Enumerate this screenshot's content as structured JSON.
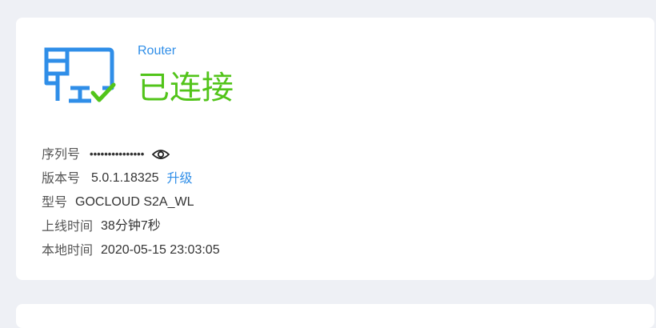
{
  "device": {
    "name": "Router",
    "status": "已连接",
    "icon": "router-connected-icon"
  },
  "colors": {
    "accent": "#2f8ee8",
    "connected": "#52c41a"
  },
  "info": {
    "serial_label": "序列号",
    "serial_value": "•••••••••••••••",
    "version_label": "版本号",
    "version_value": "5.0.1.18325",
    "upgrade_label": "升级",
    "model_label": "型号",
    "model_value": "GOCLOUD S2A_WL",
    "uptime_label": "上线时间",
    "uptime_value": "38分钟7秒",
    "localtime_label": "本地时间",
    "localtime_value": "2020-05-15 23:03:05"
  }
}
